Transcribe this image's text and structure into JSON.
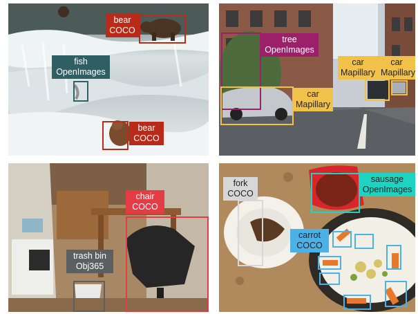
{
  "panels": [
    {
      "scene": "river with brown bears and waterfall",
      "annotations": [
        {
          "name": "bear",
          "source": "COCO",
          "color": "#b92b18",
          "text_color": "#ffffff"
        },
        {
          "name": "fish",
          "source": "OpenImages",
          "color": "#2f5e63",
          "text_color": "#ffffff"
        },
        {
          "name": "bear",
          "source": "COCO",
          "color": "#b92b18",
          "text_color": "#ffffff"
        }
      ]
    },
    {
      "scene": "city street with parked cars",
      "annotations": [
        {
          "name": "tree",
          "source": "OpenImages",
          "color": "#9c1f6a",
          "text_color": "#ffffff"
        },
        {
          "name": "car",
          "source": "Mapillary",
          "color": "#f2c14a",
          "text_color": "#222222"
        },
        {
          "name": "car",
          "source": "Mapillary",
          "color": "#f2c14a",
          "text_color": "#222222"
        },
        {
          "name": "car",
          "source": "Mapillary",
          "color": "#f2c14a",
          "text_color": "#222222"
        }
      ]
    },
    {
      "scene": "room with desk, chair and trash bin",
      "annotations": [
        {
          "name": "chair",
          "source": "COCO",
          "color": "#e43c45",
          "text_color": "#ffffff"
        },
        {
          "name": "trash bin",
          "source": "Obj365",
          "color": "#5b5f61",
          "text_color": "#ffffff"
        }
      ]
    },
    {
      "scene": "plates of food on a granite counter",
      "annotations": [
        {
          "name": "fork",
          "source": "COCO",
          "color": "#d7d7d7",
          "text_color": "#222222"
        },
        {
          "name": "sausage",
          "source": "OpenImages",
          "color": "#1ed3c2",
          "text_color": "#222222"
        },
        {
          "name": "carrot",
          "source": "COCO",
          "color": "#4cb1e6",
          "text_color": "#222222"
        }
      ]
    }
  ]
}
